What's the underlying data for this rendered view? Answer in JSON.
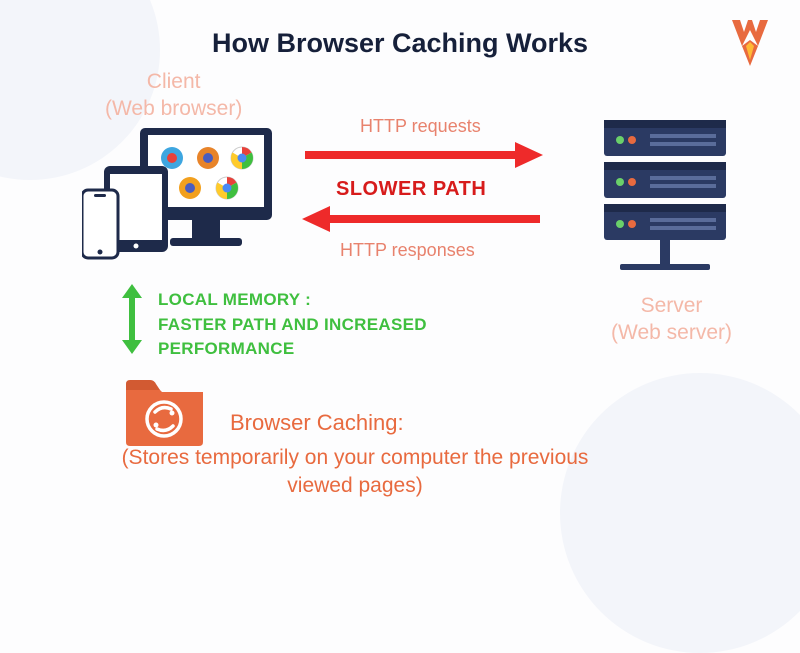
{
  "title": "How Browser Caching Works",
  "client": {
    "label_line1": "Client",
    "label_line2": "(Web browser)"
  },
  "http": {
    "request_label": "HTTP requests",
    "slower_path": "SLOWER PATH",
    "response_label": "HTTP responses"
  },
  "server": {
    "label_line1": "Server",
    "label_line2": "(Web server)"
  },
  "local_memory": {
    "line1": "LOCAL MEMORY :",
    "line2": "FASTER PATH AND INCREASED",
    "line3": "PERFORMANCE"
  },
  "cache": {
    "title": "Browser Caching:",
    "desc": "(Stores temporarily on your computer the previous viewed pages)"
  },
  "colors": {
    "navy": "#1e2a4a",
    "orange": "#e86a3f",
    "red": "#ee2a2a",
    "green": "#3fbf3f",
    "pink": "#f4b8a8"
  }
}
